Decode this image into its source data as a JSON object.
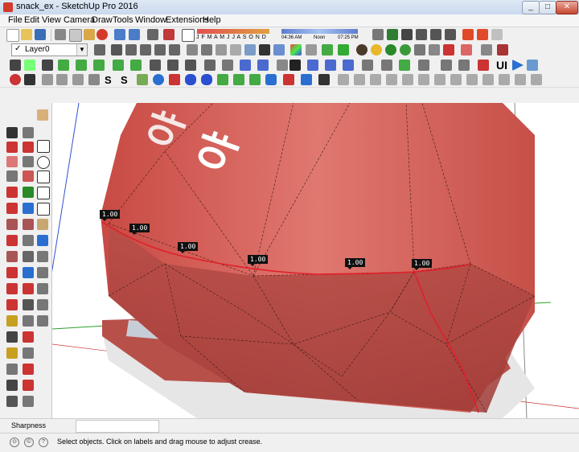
{
  "window": {
    "title": "snack_ex - SketchUp Pro 2016",
    "minimize_label": "_",
    "maximize_label": "□",
    "close_label": "✕"
  },
  "menubar": {
    "items": [
      "File",
      "Edit",
      "View",
      "Camera",
      "Draw",
      "Tools",
      "Window",
      "Extensions",
      "Help"
    ]
  },
  "shadows": {
    "months": "J F M A M J J A S O N D",
    "time_start": "04:36 AM",
    "time_mid": "Noon",
    "time_end": "07:25 PM"
  },
  "layer": {
    "current": "Layer0",
    "check": "✓"
  },
  "viewport": {
    "crease_labels": [
      "1.00",
      "1.00",
      "1.00",
      "1.00",
      "1.00",
      "1.00"
    ],
    "colors": {
      "bag_red": "#d9574f",
      "bag_light": "#e8857c",
      "edge_highlight": "#e0202a",
      "axis_green": "#2aa02a",
      "axis_blue": "#3050d0"
    }
  },
  "toolbar_text": {
    "ui_label": "UI"
  },
  "vcb": {
    "label": "Sharpness",
    "value": ""
  },
  "status": {
    "message": "Select objects. Click on labels and drag mouse to adjust crease."
  }
}
